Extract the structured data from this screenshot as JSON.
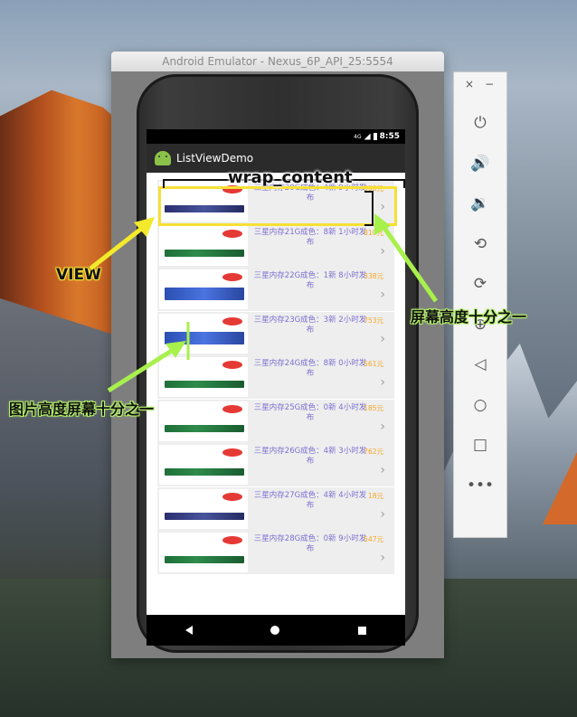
{
  "emulator": {
    "window_title": "Android Emulator - Nexus_6P_API_25:5554",
    "toolbar": {
      "close": "×",
      "minimize": "−",
      "buttons": [
        "power-icon",
        "volume-up-icon",
        "volume-down-icon",
        "rotate-left-icon",
        "rotate-right-icon",
        "zoom-icon",
        "back-icon",
        "home-icon",
        "overview-icon",
        "more-icon"
      ]
    }
  },
  "device": {
    "status": {
      "network": "4G",
      "time": "8:55"
    },
    "app_title": "ListViewDemo",
    "items": [
      {
        "title": "三星内存20G成色：4新 9小时发布",
        "price": "300元",
        "ram": "purple"
      },
      {
        "title": "三星内存21G成色：8新 1小时发布",
        "price": "810元",
        "ram": "green"
      },
      {
        "title": "三星内存22G成色：1新 8小时发布",
        "price": "338元",
        "ram": "blue"
      },
      {
        "title": "三星内存23G成色：3新 2小时发布",
        "price": "753元",
        "ram": "blue"
      },
      {
        "title": "三星内存24G成色：8新 0小时发布",
        "price": "561元",
        "ram": "green"
      },
      {
        "title": "三星内存25G成色：0新 4小时发布",
        "price": "185元",
        "ram": "green"
      },
      {
        "title": "三星内存26G成色：4新 3小时发布",
        "price": "762元",
        "ram": "green"
      },
      {
        "title": "三星内存27G成色：4新 4小时发布",
        "price": "18元",
        "ram": "purple"
      },
      {
        "title": "三星内存28G成色：0新 9小时发布",
        "price": "547元",
        "ram": "green"
      }
    ]
  },
  "annotations": {
    "wrap_content": "wrap_content",
    "view": "VIEW",
    "screen_height_tenth": "屏幕高度十分之一",
    "image_height_tenth": "图片高度屏幕十分之一"
  },
  "colors": {
    "highlight": "#f7e034",
    "arrow_yellow": "#f2ea2b",
    "arrow_green": "#a8f04c",
    "item_title": "#7b6fd0",
    "item_price": "#f5a623"
  }
}
